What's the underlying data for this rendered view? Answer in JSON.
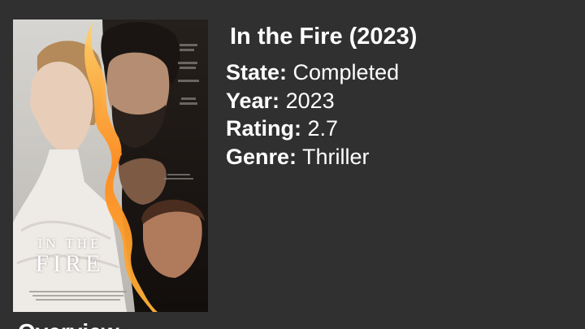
{
  "movie": {
    "title": "In the Fire (2023)",
    "poster": {
      "title_line1": "IN THE",
      "title_line2": "FIRE"
    }
  },
  "details": {
    "state_label": "State:",
    "state_value": "Completed",
    "year_label": "Year:",
    "year_value": "2023",
    "rating_label": "Rating:",
    "rating_value": "2.7",
    "genre_label": "Genre:",
    "genre_value": "Thriller"
  },
  "footer": {
    "partial_heading": "Overview"
  },
  "colors": {
    "background": "#303030",
    "text": "#ffffff"
  }
}
